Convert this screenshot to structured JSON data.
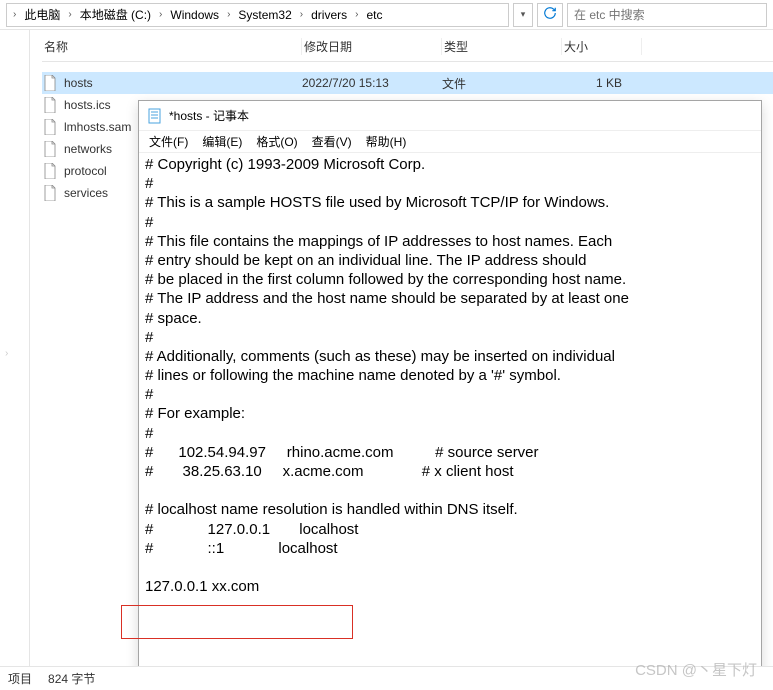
{
  "breadcrumb": {
    "items": [
      "此电脑",
      "本地磁盘 (C:)",
      "Windows",
      "System32",
      "drivers",
      "etc"
    ]
  },
  "search": {
    "placeholder": "在 etc 中搜索"
  },
  "columns": {
    "name": "名称",
    "date": "修改日期",
    "type": "类型",
    "size": "大小"
  },
  "files": [
    {
      "name": "hosts",
      "date": "2022/7/20 15:13",
      "type": "文件",
      "size": "1 KB",
      "selected": true
    },
    {
      "name": "hosts.ics",
      "date": "",
      "type": "",
      "size": ""
    },
    {
      "name": "lmhosts.sam",
      "date": "",
      "type": "",
      "size": ""
    },
    {
      "name": "networks",
      "date": "",
      "type": "",
      "size": ""
    },
    {
      "name": "protocol",
      "date": "",
      "type": "",
      "size": ""
    },
    {
      "name": "services",
      "date": "",
      "type": "",
      "size": ""
    }
  ],
  "notepad": {
    "title": "*hosts - 记事本",
    "menu": [
      "文件(F)",
      "编辑(E)",
      "格式(O)",
      "查看(V)",
      "帮助(H)"
    ],
    "content": "# Copyright (c) 1993-2009 Microsoft Corp.\n#\n# This is a sample HOSTS file used by Microsoft TCP/IP for Windows.\n#\n# This file contains the mappings of IP addresses to host names. Each\n# entry should be kept on an individual line. The IP address should\n# be placed in the first column followed by the corresponding host name.\n# The IP address and the host name should be separated by at least one\n# space.\n#\n# Additionally, comments (such as these) may be inserted on individual\n# lines or following the machine name denoted by a '#' symbol.\n#\n# For example:\n#\n#      102.54.94.97     rhino.acme.com          # source server\n#       38.25.63.10     x.acme.com              # x client host\n\n# localhost name resolution is handled within DNS itself.\n#             127.0.0.1       localhost\n#             ::1             localhost\n\n127.0.0.1 xx.com"
  },
  "status": {
    "items_label": "项目",
    "size_label": "824 字节"
  },
  "watermark": "CSDN @丶星下灯"
}
